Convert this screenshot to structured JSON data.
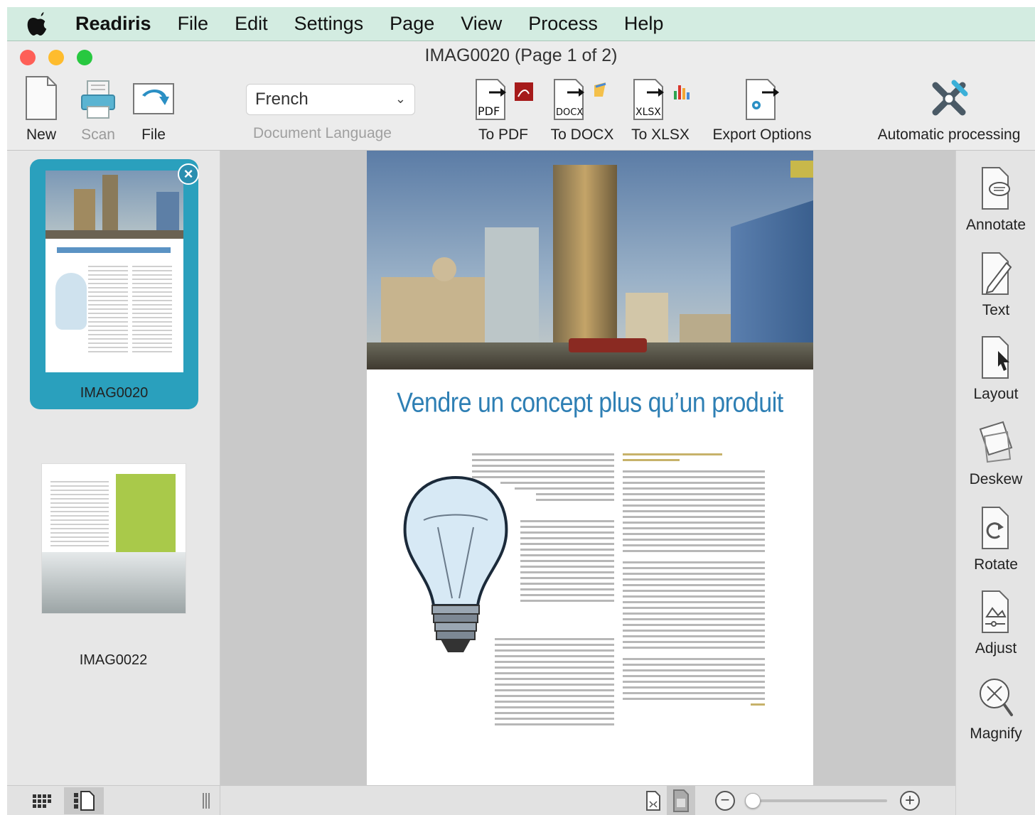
{
  "menubar": {
    "app": "Readiris",
    "items": [
      "File",
      "Edit",
      "Settings",
      "Page",
      "View",
      "Process",
      "Help"
    ]
  },
  "window": {
    "title": "IMAG0020 (Page 1 of 2)"
  },
  "toolbar": {
    "new_label": "New",
    "scan_label": "Scan",
    "file_label": "File",
    "language_value": "French",
    "language_label": "Document Language",
    "pdf_label": "To PDF",
    "docx_label": "To DOCX",
    "xlsx_label": "To XLSX",
    "export_label": "Export Options",
    "auto_label": "Automatic processing",
    "pdf_tag": "PDF",
    "docx_tag": "DOCX",
    "xlsx_tag": "XLSX"
  },
  "thumbnails": [
    {
      "name": "IMAG0020",
      "selected": true
    },
    {
      "name": "IMAG0022",
      "selected": false
    }
  ],
  "document": {
    "title": "Vendre un concept plus qu’un produit"
  },
  "right_tools": [
    "Annotate",
    "Text",
    "Layout",
    "Deskew",
    "Rotate",
    "Adjust",
    "Magnify"
  ],
  "colors": {
    "menubar_bg": "#d3ece1",
    "selection": "#2aa0bd",
    "doc_title": "#2e7fb4",
    "close": "#fe5f57",
    "minimize": "#febc2e",
    "zoom": "#28c840"
  },
  "zoom": {
    "level": 0.0
  }
}
